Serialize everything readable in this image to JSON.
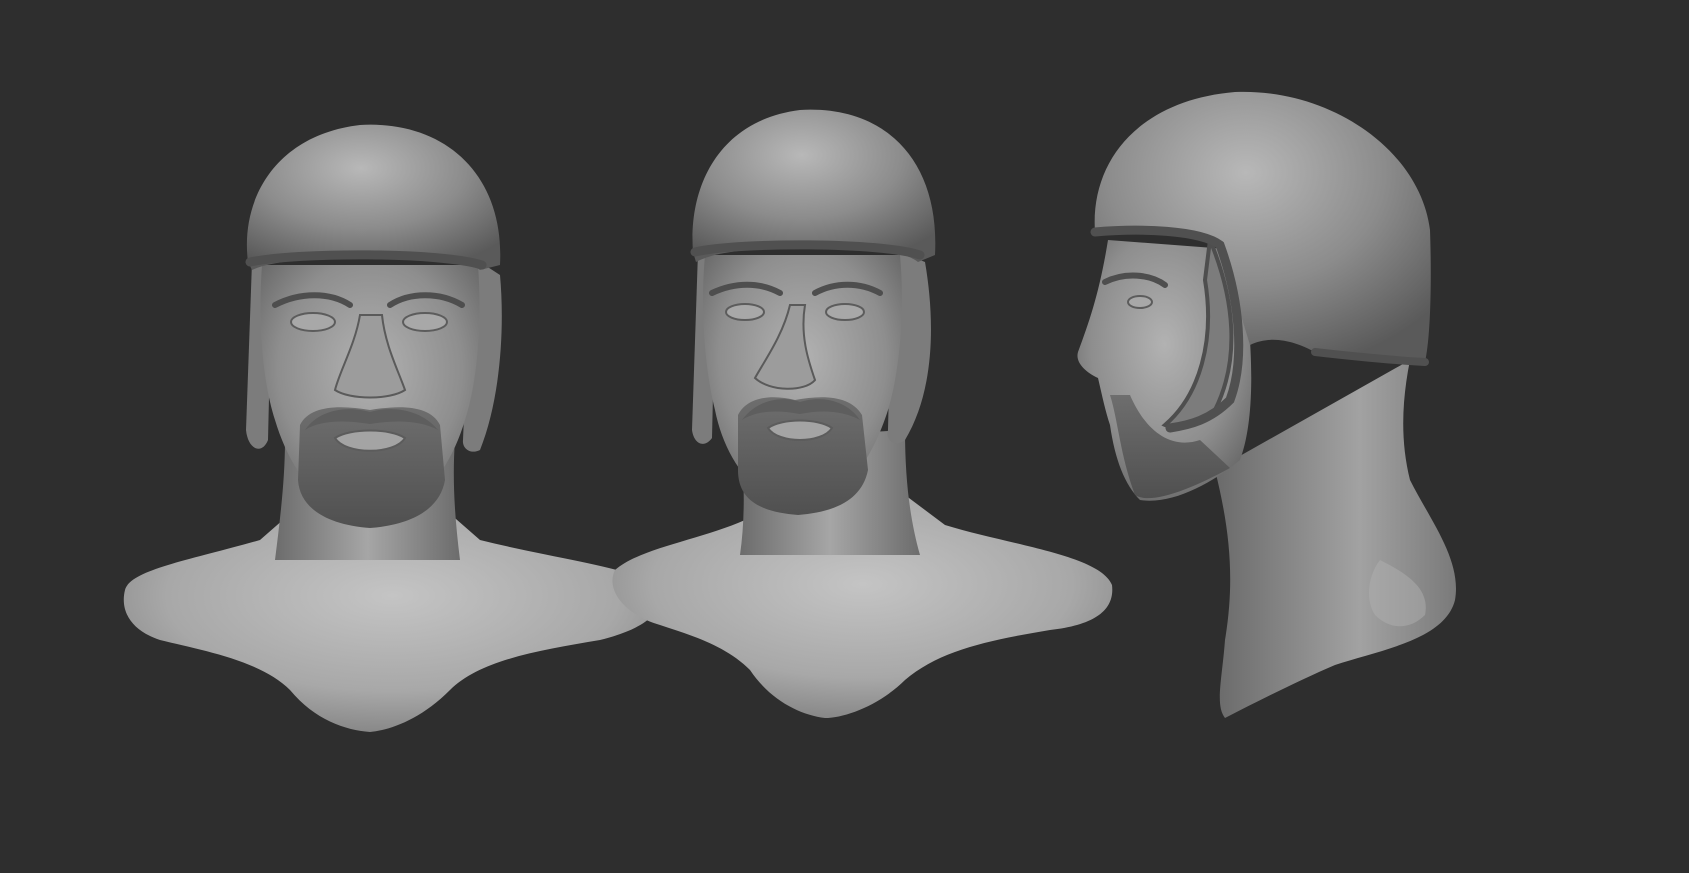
{
  "scene": {
    "background_color": "#2e2e2e",
    "material_color": "#9a9a9a",
    "views": [
      {
        "view": "front",
        "name": "bust-front-view"
      },
      {
        "view": "three-quarter",
        "name": "bust-three-quarter-view"
      },
      {
        "view": "profile",
        "name": "bust-profile-view"
      }
    ]
  }
}
